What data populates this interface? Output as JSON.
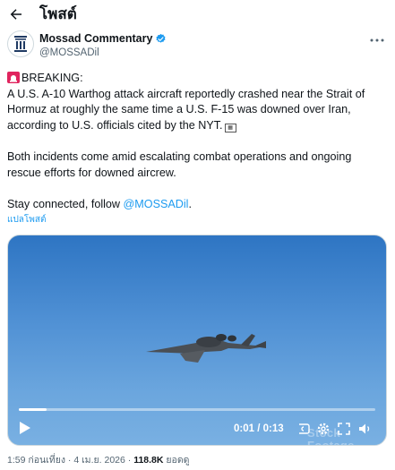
{
  "topbar": {
    "back_icon": "arrow-left-icon",
    "title": "โพสต์"
  },
  "author": {
    "display_name": "Mossad Commentary",
    "handle": "@MOSSADil",
    "verified_icon": "verified-badge-icon",
    "verified_color": "#1d9bf0",
    "avatar_icon": "emblem-avatar-icon",
    "more_icon": "more-horizontal-icon"
  },
  "tweet": {
    "siren_icon": "police-siren-icon",
    "line_breaking": "BREAKING:",
    "paragraph_1_main": "A U.S. A-10 Warthog attack aircraft reportedly crashed near the Strait of Hormuz at roughly the same time a U.S. F-15 was downed over Iran, according to U.S. officials cited by the NYT.",
    "nyt_glyph_icon": "newspaper-glyph-icon",
    "paragraph_2": "Both incidents come amid escalating combat operations and ongoing rescue efforts for downed aircrew.",
    "paragraph_3_prefix": "Stay connected, follow ",
    "paragraph_3_mention": "@MOSSADil",
    "paragraph_3_suffix": ".",
    "mention_color": "#1d9bf0"
  },
  "translate_link": "แปลโพสต์",
  "video": {
    "play_icon": "play-icon",
    "time": "0:01 / 0:13",
    "progress": 0.077,
    "subtitles_icon": "subtitles-icon",
    "settings_icon": "gear-icon",
    "fullscreen_icon": "fullscreen-icon",
    "mute_icon": "speaker-icon",
    "watermark": "Stock Footage",
    "aircraft_icon": "a10-aircraft-image"
  },
  "meta": {
    "timestamp": "1:59 ก่อนเที่ยง · 4 เม.ย. 2026 ·",
    "views_count": "118.8K",
    "views_label": "ยอดดู"
  }
}
